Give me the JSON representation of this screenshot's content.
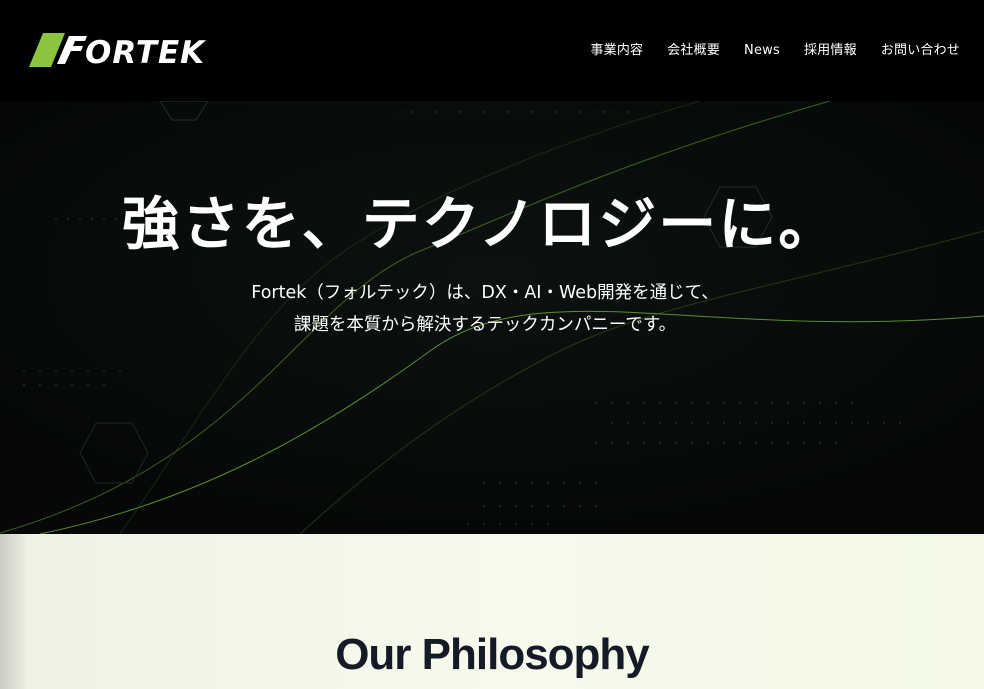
{
  "brand": {
    "name": "FORTEK",
    "accent": "#8bc53f"
  },
  "nav": {
    "items": [
      "事業内容",
      "会社概要",
      "News",
      "採用情報",
      "お問い合わせ"
    ]
  },
  "hero": {
    "title": "強さを、テクノロジーに。",
    "subtitle_line1": "Fortek（フォルテック）は、DX・AI・Web開発を通じて、",
    "subtitle_line2": "課題を本質から解決するテックカンパニーです。",
    "background": "#060a09",
    "line_color": "#7fc241"
  },
  "philosophy": {
    "heading": "Our Philosophy",
    "heading_color": "#141a26"
  }
}
